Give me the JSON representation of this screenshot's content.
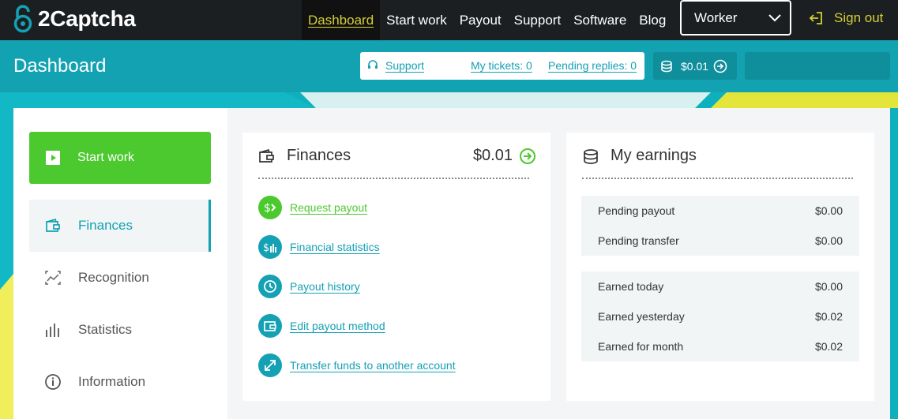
{
  "brand": {
    "name": "2Captcha"
  },
  "nav": {
    "items": [
      {
        "label": "Dashboard",
        "active": true
      },
      {
        "label": "Start work"
      },
      {
        "label": "Payout"
      },
      {
        "label": "Support"
      },
      {
        "label": "Software"
      },
      {
        "label": "Blog"
      }
    ],
    "role_select": "Worker",
    "sign_out": "Sign out"
  },
  "header": {
    "title": "Dashboard",
    "support_label": "Support",
    "my_tickets": "My tickets: 0",
    "pending_replies": "Pending replies: 0",
    "balance": "$0.01"
  },
  "sidebar": {
    "start_work": "Start work",
    "items": [
      {
        "label": "Finances",
        "icon": "wallet-icon",
        "active": true
      },
      {
        "label": "Recognition",
        "icon": "recognition-icon"
      },
      {
        "label": "Statistics",
        "icon": "bar-chart-icon"
      },
      {
        "label": "Information",
        "icon": "info-icon"
      }
    ]
  },
  "finances": {
    "title": "Finances",
    "amount": "$0.01",
    "links": [
      {
        "label": "Request payout",
        "icon": "dollar-arrow-icon",
        "color": "#4cc92e"
      },
      {
        "label": "Financial statistics",
        "icon": "dollar-bars-icon",
        "color": "#14a1b4"
      },
      {
        "label": "Payout history",
        "icon": "history-clock-icon",
        "color": "#14a1b4"
      },
      {
        "label": "Edit payout method",
        "icon": "wallet-icon",
        "color": "#14a1b4"
      },
      {
        "label": "Transfer funds to another account",
        "icon": "transfer-arrows-icon",
        "color": "#14a1b4"
      }
    ]
  },
  "earnings": {
    "title": "My earnings",
    "pending": [
      {
        "label": "Pending payout",
        "value": "$0.00"
      },
      {
        "label": "Pending transfer",
        "value": "$0.00"
      }
    ],
    "earned": [
      {
        "label": "Earned today",
        "value": "$0.00"
      },
      {
        "label": "Earned yesterday",
        "value": "$0.02"
      },
      {
        "label": "Earned for month",
        "value": "$0.02"
      }
    ]
  },
  "colors": {
    "topbar": "#1c1f22",
    "accent_teal": "#14a1b4",
    "accent_green": "#4cc92e",
    "accent_yellow": "#d4cf35"
  }
}
